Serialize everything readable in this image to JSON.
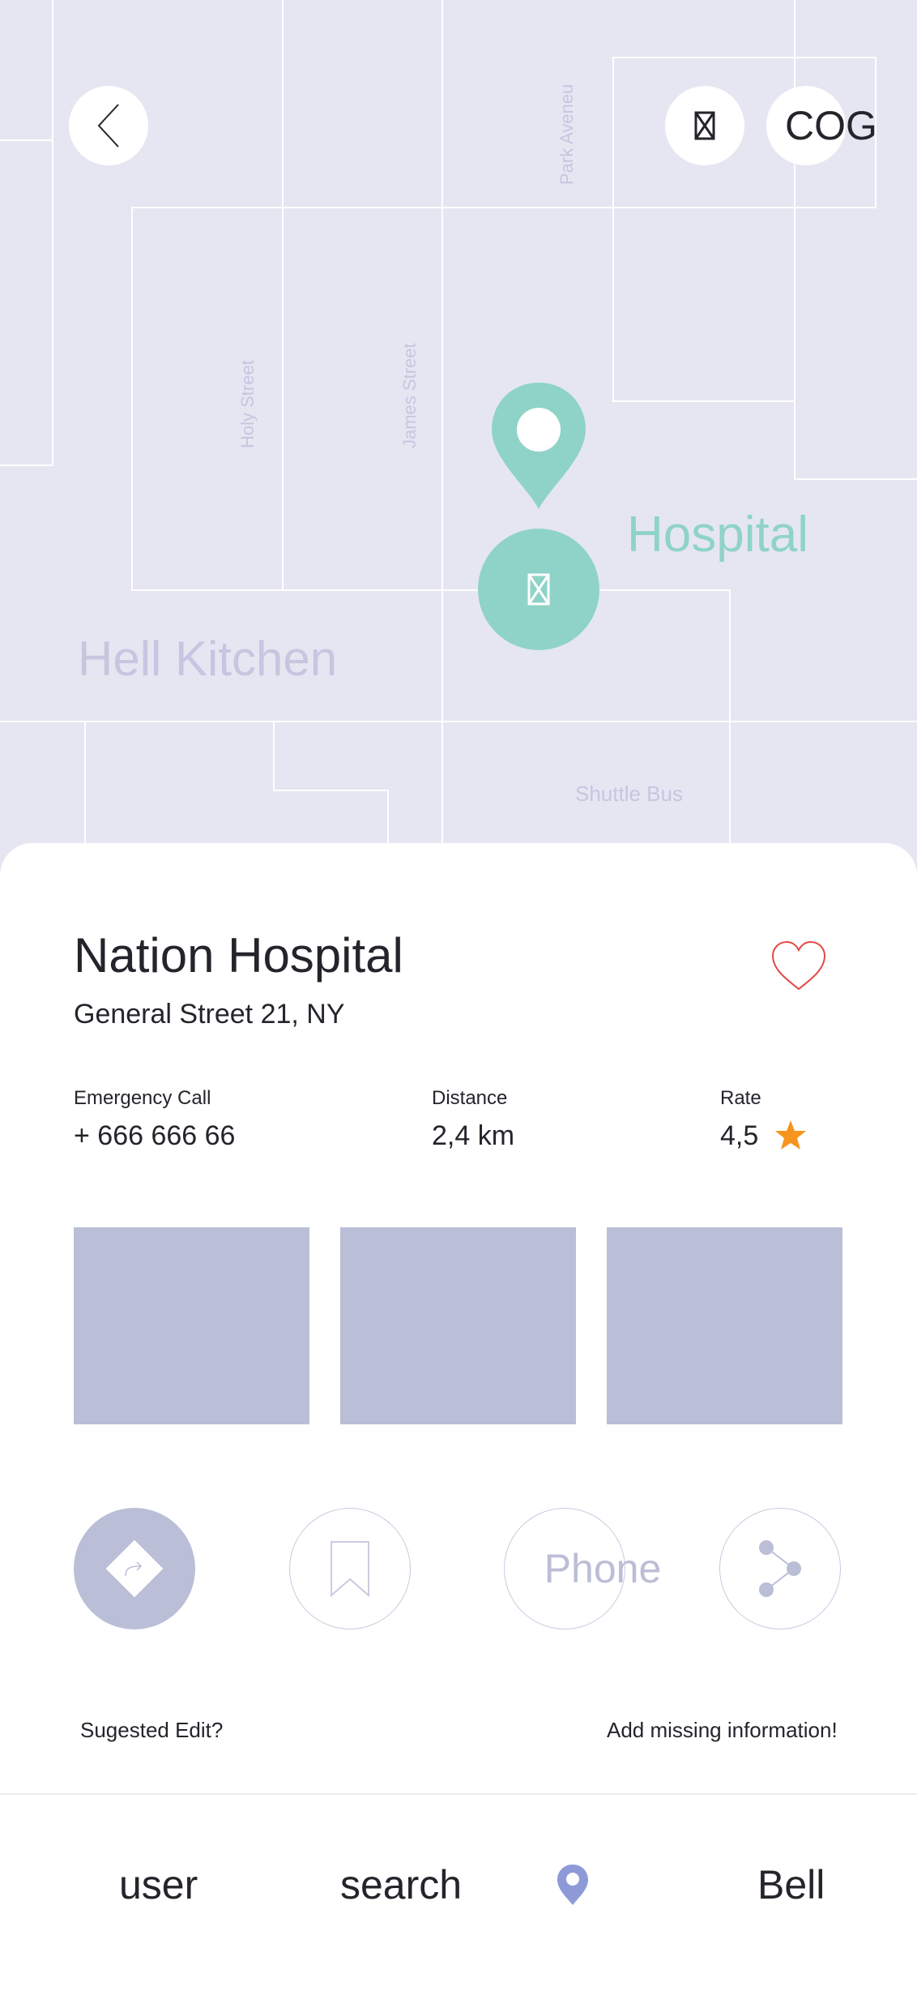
{
  "map": {
    "streets": {
      "park": "Park Aveneu",
      "holy": "Holy Street",
      "james": "James Street"
    },
    "area_label": "Hell Kitchen",
    "shuttle_label": "Shuttle Bus",
    "place_label": "Hospital",
    "marker_icon": "map-pin",
    "settings_label": "COG",
    "accent": "#8fd3c8"
  },
  "place": {
    "name": "Nation Hospital",
    "address": "General Street 21, NY",
    "favorite_icon": "heart",
    "emergency_label": "Emergency Call",
    "emergency_value": "+ 666 666 66",
    "distance_label": "Distance",
    "distance_value": "2,4 km",
    "rate_label": "Rate",
    "rate_value": "4,5",
    "star_color": "#f7941d"
  },
  "actions": {
    "directions_icon": "directions",
    "bookmark_icon": "bookmark",
    "phone_label": "Phone",
    "share_icon": "share"
  },
  "links": {
    "suggest": "Sugested Edit?",
    "missing": "Add missing information!"
  },
  "nav": {
    "user": "user",
    "search": "search",
    "location_icon": "location-pin",
    "bell": "Bell",
    "active_color": "#8e9ad8"
  }
}
